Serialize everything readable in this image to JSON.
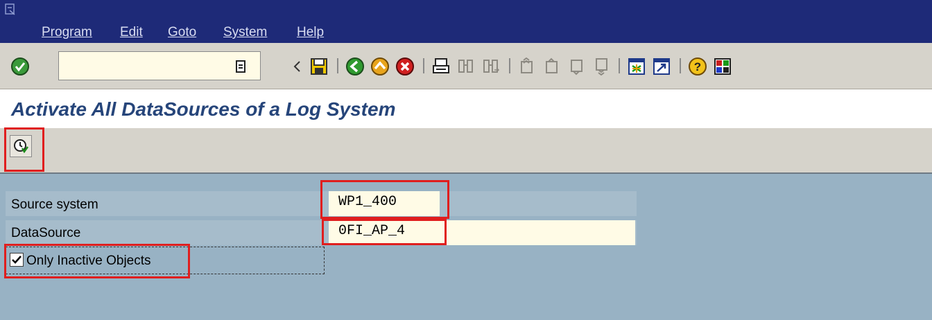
{
  "menubar": {
    "items": [
      "Program",
      "Edit",
      "Goto",
      "System",
      "Help"
    ],
    "icon": "system-menu-icon"
  },
  "toolbar": {
    "command_field_value": "",
    "icons": [
      "enter-icon",
      "command-dropdown-icon",
      "back-arrow-icon",
      "save-icon",
      "back-icon",
      "exit-icon",
      "cancel-icon",
      "print-icon",
      "find-icon",
      "find-next-icon",
      "first-page-icon",
      "previous-page-icon",
      "next-page-icon",
      "last-page-icon",
      "create-session-icon",
      "shortcut-icon",
      "help-icon",
      "layout-menu-icon"
    ]
  },
  "page": {
    "title": "Activate All DataSources of a Log System"
  },
  "app_toolbar": {
    "execute_icon": "execute-icon"
  },
  "form": {
    "source_system_label": "Source system",
    "source_system_value": "WP1_400",
    "datasource_label": "DataSource",
    "datasource_value": "0FI_AP_4",
    "only_inactive_label": "Only Inactive Objects",
    "only_inactive_checked": true
  },
  "colors": {
    "menubar_bg": "#1e2a78",
    "toolbar_bg": "#d6d3cb",
    "content_bg": "#98b2c4",
    "title_color": "#26457a",
    "highlight": "#e01e1e",
    "input_bg": "#fffbe6"
  }
}
